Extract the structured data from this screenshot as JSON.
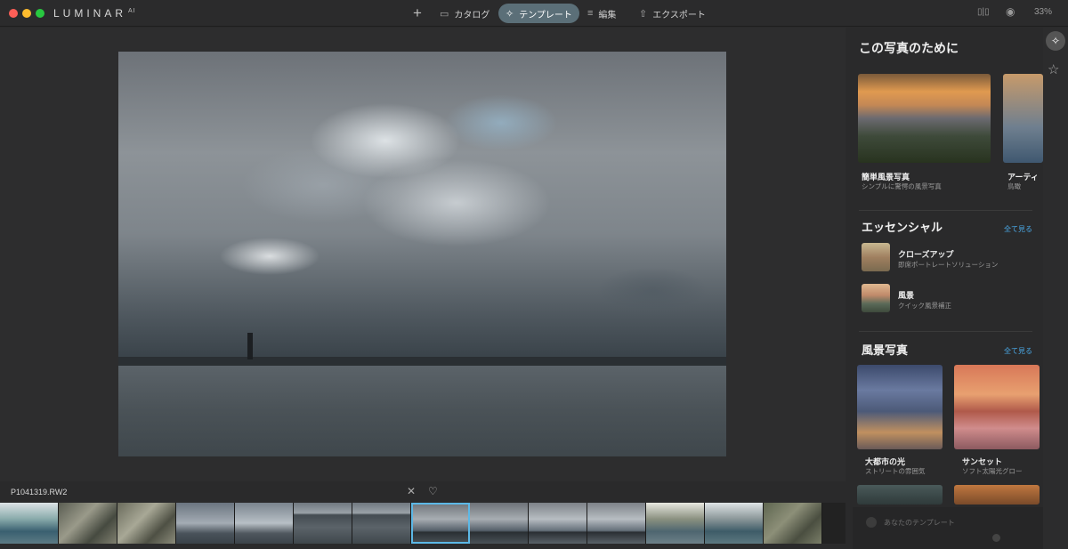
{
  "window": {
    "app_name": "LUMINAR",
    "app_suffix": "AI",
    "zoom": "33%"
  },
  "toolbar": {
    "add_label": "+",
    "catalog_label": "カタログ",
    "templates_label": "テンプレート",
    "edit_label": "編集",
    "export_label": "エクスポート"
  },
  "photo": {
    "filename": "P1041319.RW2"
  },
  "filmstrip": {
    "count": 14,
    "selected_index": 6
  },
  "panel": {
    "for_this_photo": {
      "title": "この写真のために",
      "cards": [
        {
          "title": "簡単風景写真",
          "subtitle": "シンプルに驚愕の風景写真"
        },
        {
          "title": "アーティ",
          "subtitle": "鳥瞰"
        }
      ]
    },
    "essentials": {
      "title": "エッセンシャル",
      "see_all": "全て見る",
      "items": [
        {
          "title": "クローズアップ",
          "subtitle": "即席ポートレートソリューション"
        },
        {
          "title": "風景",
          "subtitle": "クイック風景補正"
        }
      ]
    },
    "landscape": {
      "title": "風景写真",
      "see_all": "全て見る",
      "cards": [
        {
          "title": "大都市の光",
          "subtitle": "ストリートの雰囲気"
        },
        {
          "title": "サンセット",
          "subtitle": "ソフト太陽光グロー"
        }
      ]
    },
    "my_templates_label": "あなたのテンプレート"
  },
  "colors": {
    "accent": "#5cb8e6",
    "active_tab": "#5b6f78",
    "link": "#4aa8e6"
  }
}
